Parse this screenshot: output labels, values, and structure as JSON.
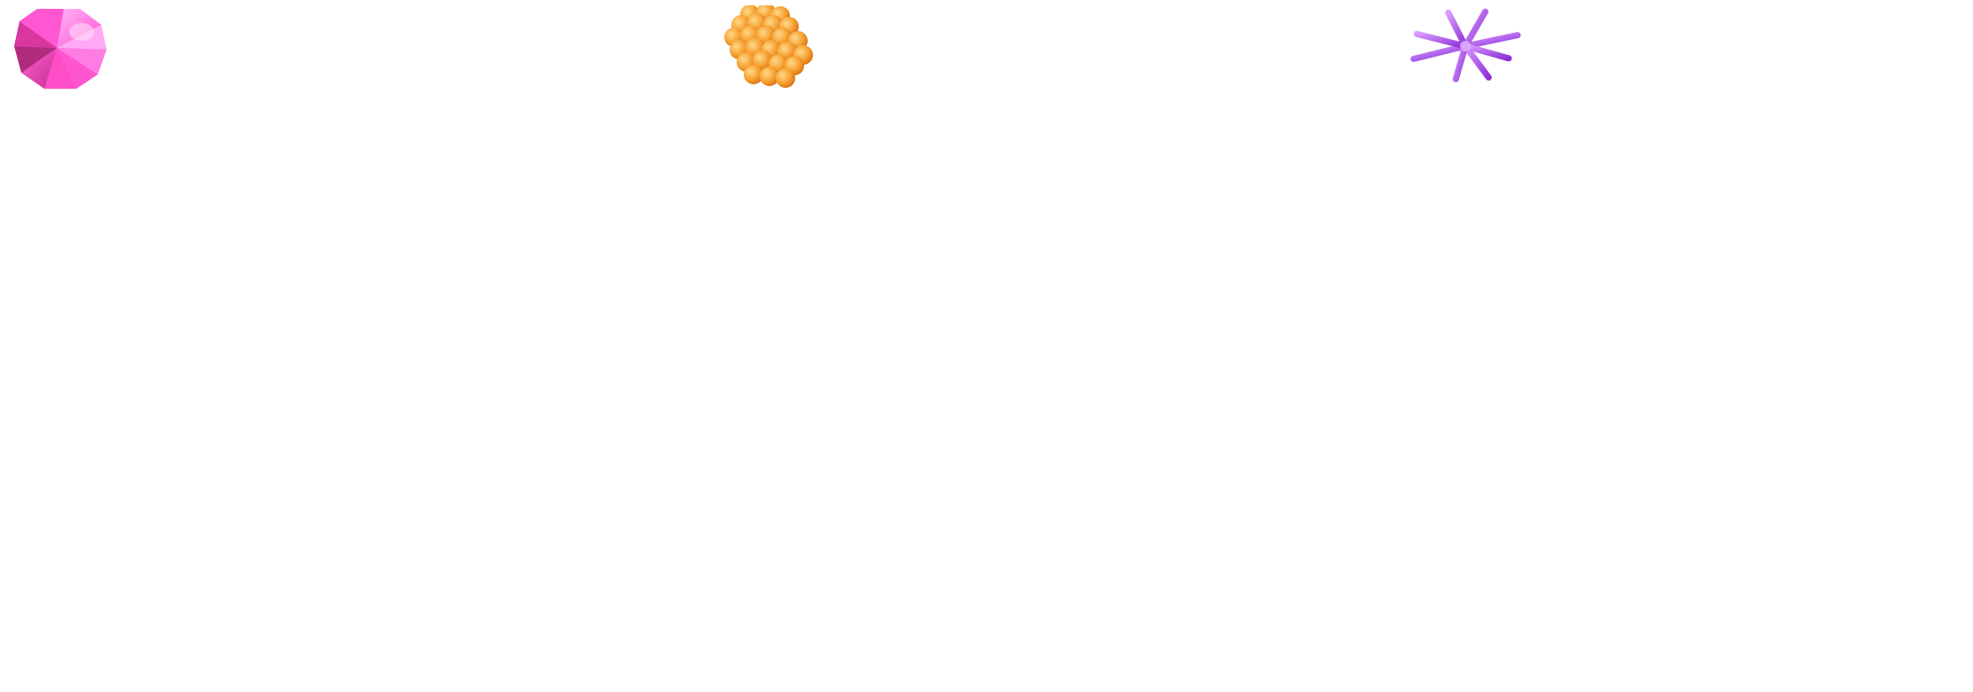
{
  "shapes": [
    {
      "icon": "pink-polyhedron-icon",
      "colors": {
        "light": "#ff9df4",
        "mid": "#ff4fd0",
        "dark": "#c62f8c"
      }
    },
    {
      "icon": "orange-bubble-cluster-icon",
      "colors": {
        "light": "#ffd27a",
        "mid": "#f7a132",
        "dark": "#d66a12"
      }
    },
    {
      "icon": "purple-asterisk-icon",
      "colors": {
        "light": "#d79bff",
        "mid": "#b14bf0",
        "dark": "#7d24c8"
      }
    }
  ]
}
